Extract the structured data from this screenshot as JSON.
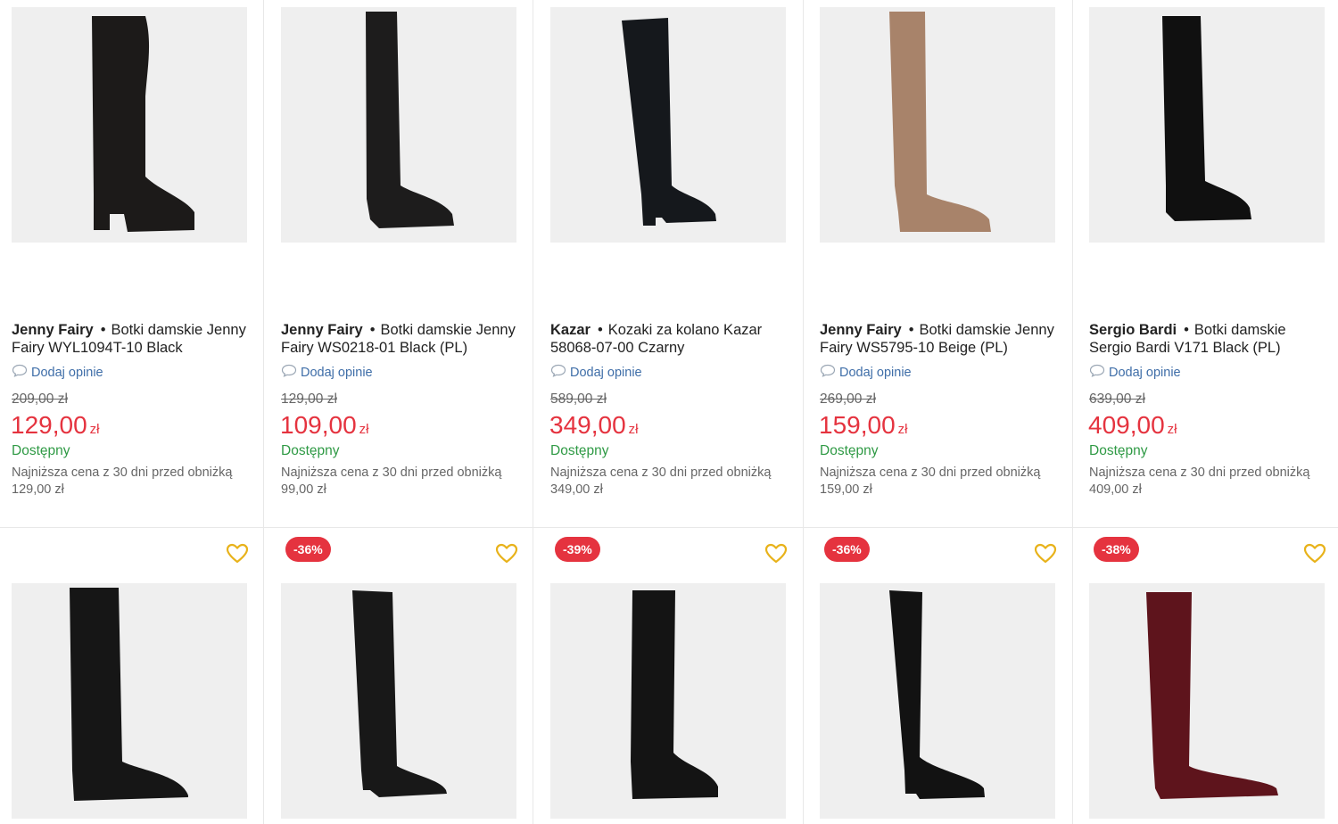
{
  "review_label": "Dodaj opinie",
  "availability_label": "Dostępny",
  "currency": "zł",
  "lowest_price_note": "Najniższa cena z 30 dni przed obniżką",
  "products_row1": [
    {
      "brand": "Jenny Fairy",
      "name": "Botki damskie Jenny Fairy WYL1094T-10 Black",
      "old_price": "209,00 zł",
      "price": "129,00",
      "lowest_price": "129,00 zł",
      "boot_color": "#1c1a19"
    },
    {
      "brand": "Jenny Fairy",
      "name": "Botki damskie Jenny Fairy WS0218-01 Black (PL)",
      "old_price": "129,00 zł",
      "price": "109,00",
      "lowest_price": "99,00 zł",
      "boot_color": "#1d1c1c"
    },
    {
      "brand": "Kazar",
      "name": "Kozaki za kolano Kazar 58068-07-00 Czarny",
      "old_price": "589,00 zł",
      "price": "349,00",
      "lowest_price": "349,00 zł",
      "boot_color": "#15181c"
    },
    {
      "brand": "Jenny Fairy",
      "name": "Botki damskie Jenny Fairy WS5795-10 Beige (PL)",
      "old_price": "269,00 zł",
      "price": "159,00",
      "lowest_price": "159,00 zł",
      "boot_color": "#a8836a"
    },
    {
      "brand": "Sergio Bardi",
      "name": "Botki damskie Sergio Bardi V171 Black (PL)",
      "old_price": "639,00 zł",
      "price": "409,00",
      "lowest_price": "409,00 zł",
      "boot_color": "#101010"
    }
  ],
  "products_row2": [
    {
      "badge": "",
      "boot_color": "#161616"
    },
    {
      "badge": "-36%",
      "boot_color": "#181818"
    },
    {
      "badge": "-39%",
      "boot_color": "#141414"
    },
    {
      "badge": "-36%",
      "boot_color": "#121212"
    },
    {
      "badge": "-38%",
      "boot_color": "#5e141c"
    }
  ],
  "colors": {
    "price": "#e5333f",
    "available": "#2f9a45",
    "link": "#3f6ea8",
    "heart": "#e8b21a"
  }
}
